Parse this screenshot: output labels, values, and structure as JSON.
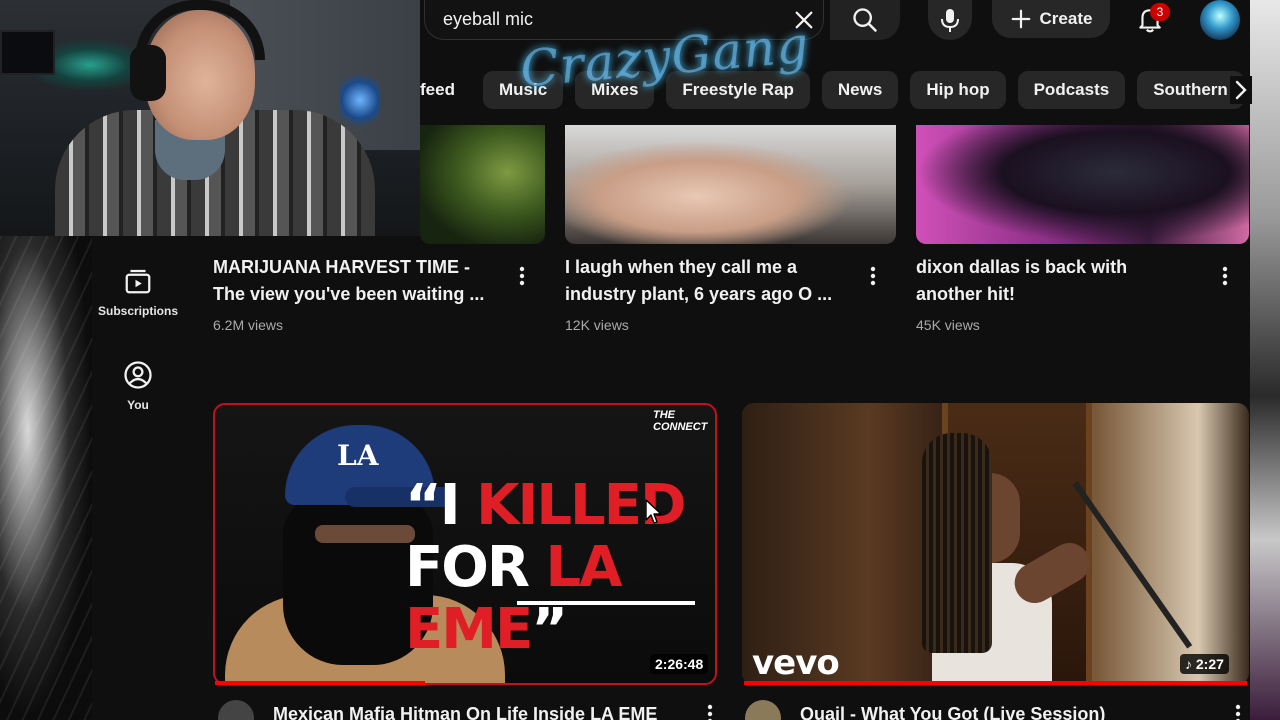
{
  "search": {
    "query": "eyeball mic"
  },
  "header": {
    "create_label": "Create",
    "notification_count": "3"
  },
  "overlay_logo_text": "CrazyGang",
  "chips": [
    {
      "label": "feed"
    },
    {
      "label": "Music"
    },
    {
      "label": "Mixes"
    },
    {
      "label": "Freestyle Rap"
    },
    {
      "label": "News"
    },
    {
      "label": "Hip hop"
    },
    {
      "label": "Podcasts"
    },
    {
      "label": "Southern"
    }
  ],
  "sidebar": {
    "items": [
      {
        "label": "Subscriptions",
        "icon": "subscriptions-icon"
      },
      {
        "label": "You",
        "icon": "user-circle-icon"
      }
    ]
  },
  "videos_top": [
    {
      "title_line1": "MARIJUANA HARVEST TIME -",
      "title_line2": "The view you've been waiting ...",
      "views": "6.2M views"
    },
    {
      "title_line1": "I laugh when they call me a",
      "title_line2": "industry plant, 6 years ago O ...",
      "views": "12K views"
    },
    {
      "title_line1": "dixon dallas is back with",
      "title_line2": "another hit!",
      "views": "45K views"
    }
  ],
  "videos_bottom": [
    {
      "title": "Mexican Mafia Hitman On Life Inside LA EME",
      "duration": "2:26:48",
      "thumb_brand": "THE CONNECT",
      "cap_text": "LA",
      "headline_quote_open": "“I ",
      "headline_red1": "KILLED",
      "headline_white2": "FOR ",
      "headline_red2": "LA EME",
      "headline_quote_close": "”",
      "watched_progress": 0.42
    },
    {
      "title": "Quail - What You Got (Live Session)",
      "duration": "2:27",
      "thumb_brand": "vevo",
      "watched_progress": 1.0
    }
  ],
  "colors": {
    "background": "#0f0f0f",
    "accent_red": "#ff0000",
    "badge_red": "#cc0000",
    "chip_bg": "#272727",
    "meta_text": "#aaaaaa"
  }
}
